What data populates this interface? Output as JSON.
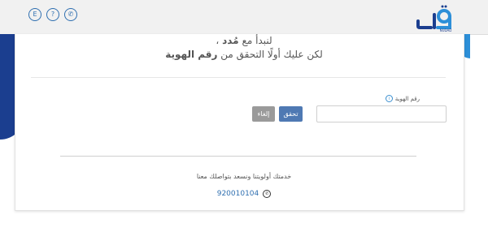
{
  "header": {
    "icons": [
      {
        "name": "language-toggle",
        "glyph": "E"
      },
      {
        "name": "help",
        "glyph": "?"
      },
      {
        "name": "phone",
        "glyph": "✆"
      }
    ],
    "logo": {
      "text": "NUDAD",
      "brand_color": "#2f6fb0"
    }
  },
  "welcome": {
    "line1_prefix": "لنبدأ مع",
    "brand_name": "مُدد",
    "line1_suffix": "،",
    "line2_prefix": "لكن عليك أولًا التحقق من",
    "line2_bold": "رقم الهوية"
  },
  "form": {
    "id_label": "رقم الهوية",
    "id_value": "",
    "verify_button": "تحقق",
    "cancel_button": "إلغاء"
  },
  "footer": {
    "service_text": "خدمتك أولويتنا ونسعد بتواصلك معنا",
    "phone": "920010104"
  },
  "colors": {
    "brand_dark": "#1b3e8f",
    "brand_light": "#2d8fd8",
    "verify_bg": "#4f79b3",
    "cancel_bg": "#9a9a9a"
  }
}
